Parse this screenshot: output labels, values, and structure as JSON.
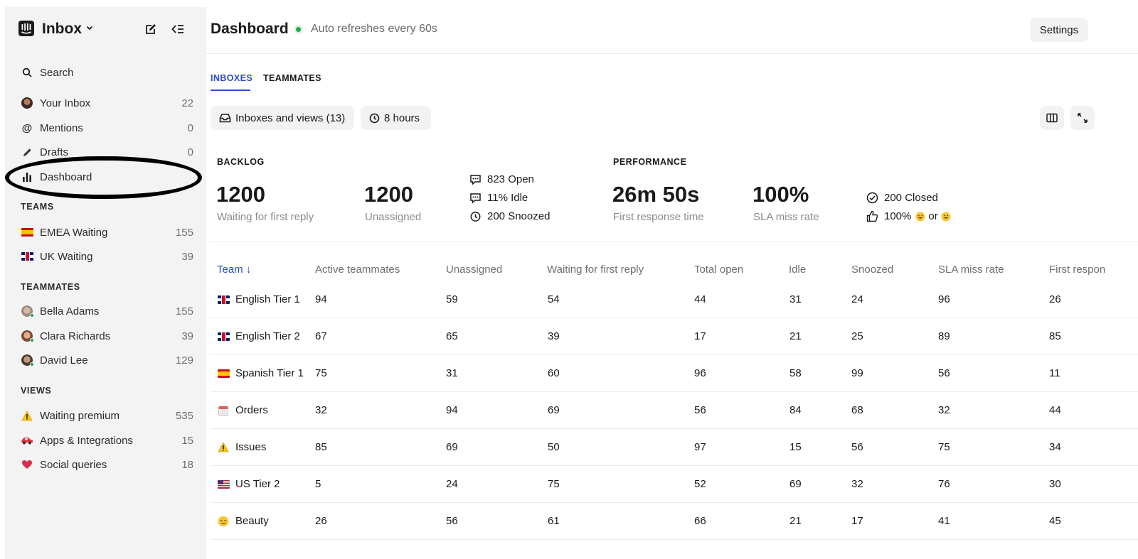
{
  "sidebar": {
    "title": "Inbox",
    "search": "Search",
    "nav": [
      {
        "label": "Your Inbox",
        "count": "22"
      },
      {
        "label": "Mentions",
        "count": "0"
      },
      {
        "label": "Drafts",
        "count": "0"
      },
      {
        "label": "Dashboard",
        "count": ""
      }
    ],
    "teams_header": "TEAMS",
    "teams": [
      {
        "label": "EMEA Waiting",
        "count": "155"
      },
      {
        "label": "UK Waiting",
        "count": "39"
      }
    ],
    "teammates_header": "TEAMMATES",
    "teammates": [
      {
        "label": "Bella Adams",
        "count": "155"
      },
      {
        "label": "Clara Richards",
        "count": "39"
      },
      {
        "label": "David Lee",
        "count": "129"
      }
    ],
    "views_header": "VIEWS",
    "views": [
      {
        "label": "Waiting premium",
        "count": "535"
      },
      {
        "label": "Apps & Integrations",
        "count": "15"
      },
      {
        "label": "Social queries",
        "count": "18"
      }
    ]
  },
  "header": {
    "title": "Dashboard",
    "refresh": "Auto refreshes every 60s",
    "settings": "Settings"
  },
  "tabs": [
    "INBOXES",
    "TEAMMATES"
  ],
  "filters": {
    "inboxes": "Inboxes and views (13)",
    "hours": "8 hours"
  },
  "backlog": {
    "header": "BACKLOG",
    "waiting_value": "1200",
    "waiting_label": "Waiting for first reply",
    "unassigned_value": "1200",
    "unassigned_label": "Unassigned",
    "open": "823 Open",
    "idle": "11% Idle",
    "snoozed": "200 Snoozed"
  },
  "performance": {
    "header": "PERFORMANCE",
    "frt_value": "26m 50s",
    "frt_label": "First response time",
    "sla_value": "100%",
    "sla_label": "SLA miss rate",
    "closed": "200 Closed",
    "csat_pct": "100%",
    "csat_or": "or"
  },
  "table": {
    "headers": [
      "Team",
      "Active teammates",
      "Unassigned",
      "Waiting for first reply",
      "Total open",
      "Idle",
      "Snoozed",
      "SLA miss rate",
      "First respon"
    ],
    "rows": [
      {
        "name": "English Tier 1",
        "icon": "flag-uk",
        "vals": [
          "94",
          "59",
          "54",
          "44",
          "31",
          "24",
          "96",
          "26"
        ]
      },
      {
        "name": "English Tier 2",
        "icon": "flag-uk",
        "vals": [
          "67",
          "65",
          "39",
          "17",
          "21",
          "25",
          "89",
          "85"
        ]
      },
      {
        "name": "Spanish Tier 1",
        "icon": "flag-es",
        "vals": [
          "75",
          "31",
          "60",
          "96",
          "58",
          "99",
          "56",
          "11"
        ]
      },
      {
        "name": "Orders",
        "icon": "calendar-icon",
        "vals": [
          "32",
          "94",
          "69",
          "56",
          "84",
          "68",
          "32",
          "44"
        ]
      },
      {
        "name": "Issues",
        "icon": "warning-icon",
        "vals": [
          "85",
          "69",
          "50",
          "97",
          "15",
          "56",
          "75",
          "34"
        ]
      },
      {
        "name": "US Tier 2",
        "icon": "flag-us",
        "vals": [
          "5",
          "24",
          "75",
          "52",
          "69",
          "32",
          "76",
          "30"
        ]
      },
      {
        "name": "Beauty",
        "icon": "relieved-face-icon",
        "vals": [
          "26",
          "56",
          "61",
          "66",
          "21",
          "17",
          "41",
          "45"
        ]
      }
    ]
  },
  "colors": {
    "accent": "#2c4bd3",
    "live": "#1fae4b",
    "sidebar_bg": "#f3f3f3"
  }
}
